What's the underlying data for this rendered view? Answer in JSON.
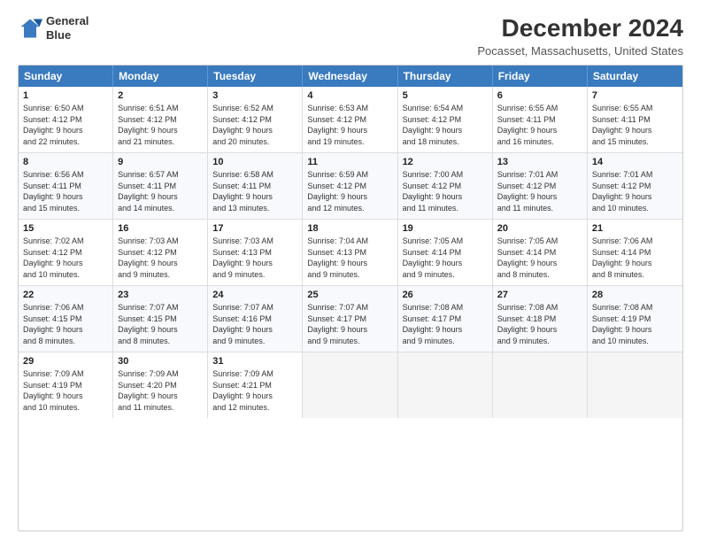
{
  "logo": {
    "line1": "General",
    "line2": "Blue"
  },
  "title": "December 2024",
  "subtitle": "Pocasset, Massachusetts, United States",
  "days_of_week": [
    "Sunday",
    "Monday",
    "Tuesday",
    "Wednesday",
    "Thursday",
    "Friday",
    "Saturday"
  ],
  "weeks": [
    [
      {
        "day": "1",
        "lines": [
          "Sunrise: 6:50 AM",
          "Sunset: 4:12 PM",
          "Daylight: 9 hours",
          "and 22 minutes."
        ]
      },
      {
        "day": "2",
        "lines": [
          "Sunrise: 6:51 AM",
          "Sunset: 4:12 PM",
          "Daylight: 9 hours",
          "and 21 minutes."
        ]
      },
      {
        "day": "3",
        "lines": [
          "Sunrise: 6:52 AM",
          "Sunset: 4:12 PM",
          "Daylight: 9 hours",
          "and 20 minutes."
        ]
      },
      {
        "day": "4",
        "lines": [
          "Sunrise: 6:53 AM",
          "Sunset: 4:12 PM",
          "Daylight: 9 hours",
          "and 19 minutes."
        ]
      },
      {
        "day": "5",
        "lines": [
          "Sunrise: 6:54 AM",
          "Sunset: 4:12 PM",
          "Daylight: 9 hours",
          "and 18 minutes."
        ]
      },
      {
        "day": "6",
        "lines": [
          "Sunrise: 6:55 AM",
          "Sunset: 4:11 PM",
          "Daylight: 9 hours",
          "and 16 minutes."
        ]
      },
      {
        "day": "7",
        "lines": [
          "Sunrise: 6:55 AM",
          "Sunset: 4:11 PM",
          "Daylight: 9 hours",
          "and 15 minutes."
        ]
      }
    ],
    [
      {
        "day": "8",
        "lines": [
          "Sunrise: 6:56 AM",
          "Sunset: 4:11 PM",
          "Daylight: 9 hours",
          "and 15 minutes."
        ]
      },
      {
        "day": "9",
        "lines": [
          "Sunrise: 6:57 AM",
          "Sunset: 4:11 PM",
          "Daylight: 9 hours",
          "and 14 minutes."
        ]
      },
      {
        "day": "10",
        "lines": [
          "Sunrise: 6:58 AM",
          "Sunset: 4:11 PM",
          "Daylight: 9 hours",
          "and 13 minutes."
        ]
      },
      {
        "day": "11",
        "lines": [
          "Sunrise: 6:59 AM",
          "Sunset: 4:12 PM",
          "Daylight: 9 hours",
          "and 12 minutes."
        ]
      },
      {
        "day": "12",
        "lines": [
          "Sunrise: 7:00 AM",
          "Sunset: 4:12 PM",
          "Daylight: 9 hours",
          "and 11 minutes."
        ]
      },
      {
        "day": "13",
        "lines": [
          "Sunrise: 7:01 AM",
          "Sunset: 4:12 PM",
          "Daylight: 9 hours",
          "and 11 minutes."
        ]
      },
      {
        "day": "14",
        "lines": [
          "Sunrise: 7:01 AM",
          "Sunset: 4:12 PM",
          "Daylight: 9 hours",
          "and 10 minutes."
        ]
      }
    ],
    [
      {
        "day": "15",
        "lines": [
          "Sunrise: 7:02 AM",
          "Sunset: 4:12 PM",
          "Daylight: 9 hours",
          "and 10 minutes."
        ]
      },
      {
        "day": "16",
        "lines": [
          "Sunrise: 7:03 AM",
          "Sunset: 4:12 PM",
          "Daylight: 9 hours",
          "and 9 minutes."
        ]
      },
      {
        "day": "17",
        "lines": [
          "Sunrise: 7:03 AM",
          "Sunset: 4:13 PM",
          "Daylight: 9 hours",
          "and 9 minutes."
        ]
      },
      {
        "day": "18",
        "lines": [
          "Sunrise: 7:04 AM",
          "Sunset: 4:13 PM",
          "Daylight: 9 hours",
          "and 9 minutes."
        ]
      },
      {
        "day": "19",
        "lines": [
          "Sunrise: 7:05 AM",
          "Sunset: 4:14 PM",
          "Daylight: 9 hours",
          "and 9 minutes."
        ]
      },
      {
        "day": "20",
        "lines": [
          "Sunrise: 7:05 AM",
          "Sunset: 4:14 PM",
          "Daylight: 9 hours",
          "and 8 minutes."
        ]
      },
      {
        "day": "21",
        "lines": [
          "Sunrise: 7:06 AM",
          "Sunset: 4:14 PM",
          "Daylight: 9 hours",
          "and 8 minutes."
        ]
      }
    ],
    [
      {
        "day": "22",
        "lines": [
          "Sunrise: 7:06 AM",
          "Sunset: 4:15 PM",
          "Daylight: 9 hours",
          "and 8 minutes."
        ]
      },
      {
        "day": "23",
        "lines": [
          "Sunrise: 7:07 AM",
          "Sunset: 4:15 PM",
          "Daylight: 9 hours",
          "and 8 minutes."
        ]
      },
      {
        "day": "24",
        "lines": [
          "Sunrise: 7:07 AM",
          "Sunset: 4:16 PM",
          "Daylight: 9 hours",
          "and 9 minutes."
        ]
      },
      {
        "day": "25",
        "lines": [
          "Sunrise: 7:07 AM",
          "Sunset: 4:17 PM",
          "Daylight: 9 hours",
          "and 9 minutes."
        ]
      },
      {
        "day": "26",
        "lines": [
          "Sunrise: 7:08 AM",
          "Sunset: 4:17 PM",
          "Daylight: 9 hours",
          "and 9 minutes."
        ]
      },
      {
        "day": "27",
        "lines": [
          "Sunrise: 7:08 AM",
          "Sunset: 4:18 PM",
          "Daylight: 9 hours",
          "and 9 minutes."
        ]
      },
      {
        "day": "28",
        "lines": [
          "Sunrise: 7:08 AM",
          "Sunset: 4:19 PM",
          "Daylight: 9 hours",
          "and 10 minutes."
        ]
      }
    ],
    [
      {
        "day": "29",
        "lines": [
          "Sunrise: 7:09 AM",
          "Sunset: 4:19 PM",
          "Daylight: 9 hours",
          "and 10 minutes."
        ]
      },
      {
        "day": "30",
        "lines": [
          "Sunrise: 7:09 AM",
          "Sunset: 4:20 PM",
          "Daylight: 9 hours",
          "and 11 minutes."
        ]
      },
      {
        "day": "31",
        "lines": [
          "Sunrise: 7:09 AM",
          "Sunset: 4:21 PM",
          "Daylight: 9 hours",
          "and 12 minutes."
        ]
      },
      {
        "day": "",
        "lines": []
      },
      {
        "day": "",
        "lines": []
      },
      {
        "day": "",
        "lines": []
      },
      {
        "day": "",
        "lines": []
      }
    ]
  ]
}
